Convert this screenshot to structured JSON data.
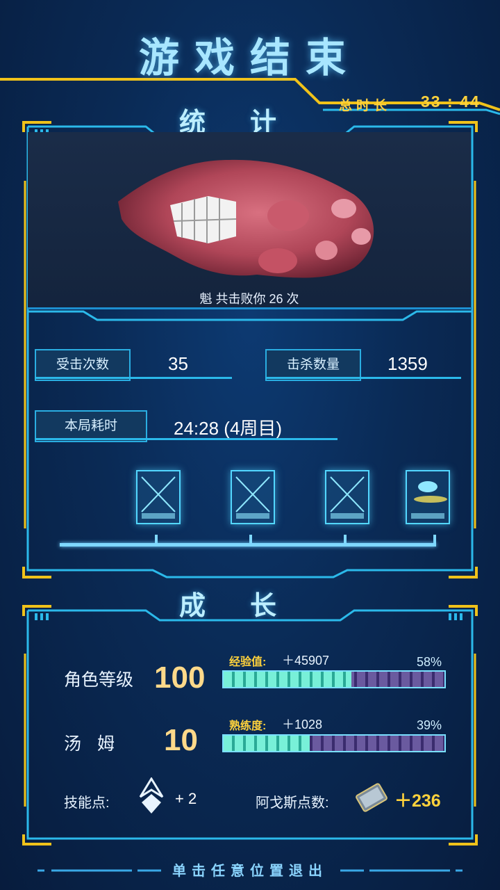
{
  "header": {
    "title": "游戏结束",
    "total_time_label": "总时长",
    "total_time_value": "33 : 44"
  },
  "stats": {
    "title": "统计",
    "boss_caption": "魁 共击败你 26 次",
    "hits_taken_label": "受击次数",
    "hits_taken_value": "35",
    "kills_label": "击杀数量",
    "kills_value": "1359",
    "round_time_label": "本局耗时",
    "round_time_value": "24:28 (4周目)",
    "cards": [
      "fish-card-icon",
      "fish-card-icon",
      "bird-card-icon",
      "weapon-card-icon"
    ]
  },
  "growth": {
    "title": "成长",
    "char_level_label": "角色等级",
    "char_level_value": "100",
    "xp_label": "经验值:",
    "xp_value": "＋45907",
    "xp_percent": "58%",
    "xp_fraction": 0.58,
    "tom_label": "汤 姆",
    "tom_level_value": "10",
    "prof_label": "熟练度:",
    "prof_value": "＋1028",
    "prof_percent": "39%",
    "prof_fraction": 0.39,
    "skill_points_label": "技能点:",
    "skill_points_value": "+ 2",
    "argus_label": "阿戈斯点数:",
    "argus_value": "＋236"
  },
  "footer": {
    "exit_hint": "单击任意位置退出"
  },
  "colors": {
    "accent": "#2bb9ea",
    "gold": "#ffd23c",
    "frame_gold": "#f0c21a"
  }
}
